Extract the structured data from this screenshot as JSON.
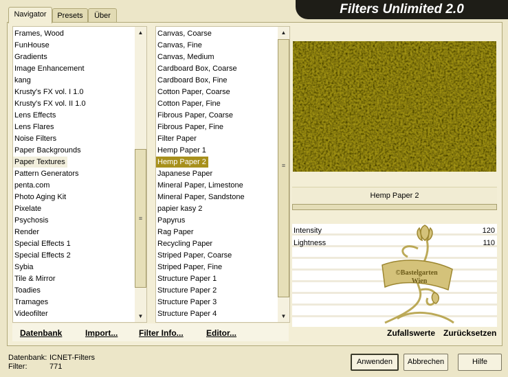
{
  "title": "Filters Unlimited 2.0",
  "tabs": [
    "Navigator",
    "Presets",
    "Über"
  ],
  "categories": [
    "Frames, Wood",
    "FunHouse",
    "Gradients",
    "Image Enhancement",
    "kang",
    "Krusty's FX vol. I 1.0",
    "Krusty's FX vol. II 1.0",
    "Lens Effects",
    "Lens Flares",
    "Noise Filters",
    "Paper Backgrounds",
    "Paper Textures",
    "Pattern Generators",
    "penta.com",
    "Photo Aging Kit",
    "Pixelate",
    "Psychosis",
    "Render",
    "Special Effects 1",
    "Special Effects 2",
    "Sybia",
    "Tile & Mirror",
    "Toadies",
    "Tramages",
    "Videofilter"
  ],
  "selected_category": "Paper Textures",
  "filters": [
    "Canvas, Coarse",
    "Canvas, Fine",
    "Canvas, Medium",
    "Cardboard Box, Coarse",
    "Cardboard Box, Fine",
    "Cotton Paper, Coarse",
    "Cotton Paper, Fine",
    "Fibrous Paper, Coarse",
    "Fibrous Paper, Fine",
    "Filter Paper",
    "Hemp Paper 1",
    "Hemp Paper 2",
    "Japanese Paper",
    "Mineral Paper, Limestone",
    "Mineral Paper, Sandstone",
    "papier kasy 2",
    "Papyrus",
    "Rag Paper",
    "Recycling Paper",
    "Striped Paper, Coarse",
    "Striped Paper, Fine",
    "Structure Paper 1",
    "Structure Paper 2",
    "Structure Paper 3",
    "Structure Paper 4"
  ],
  "selected_filter": "Hemp Paper 2",
  "preview_color": "#9d8f12",
  "filter_name": "Hemp Paper 2",
  "params": [
    {
      "label": "Intensity",
      "value": "120"
    },
    {
      "label": "Lightness",
      "value": "110"
    }
  ],
  "watermark": "©Bastelgarten Wien",
  "bottom_buttons": {
    "datenbank": "Datenbank",
    "import": "Import...",
    "filter_info": "Filter Info...",
    "editor": "Editor...",
    "zufallswerte": "Zufallswerte",
    "zuruecksetzen": "Zurücksetzen"
  },
  "status": {
    "datenbank_label": "Datenbank:",
    "datenbank_value": "ICNET-Filters",
    "filter_label": "Filter:",
    "filter_value": "771"
  },
  "dialog_buttons": {
    "apply": "Anwenden",
    "cancel": "Abbrechen",
    "help": "Hilfe"
  }
}
